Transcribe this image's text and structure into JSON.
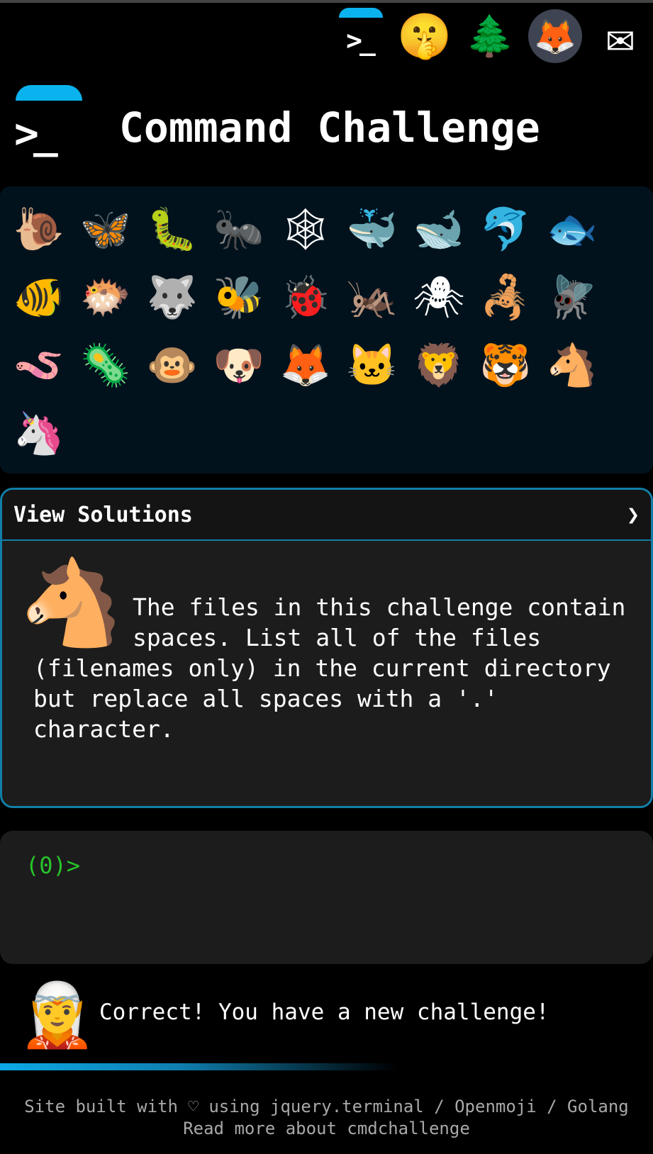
{
  "nav": {
    "terminal_glyph": ">_",
    "shush_icon": "🤫",
    "tree_icon": "🌲",
    "gitlab_icon": "🦊",
    "mail_icon": "✉"
  },
  "header": {
    "logo_glyph": ">_",
    "title": "Command Challenge"
  },
  "animals": [
    "🐌",
    "🦋",
    "🐛",
    "🐜",
    "🕸",
    "🐳",
    "🐋",
    "🐬",
    "🐟",
    "🐠",
    "🐡",
    "🐺",
    "🐝",
    "🐞",
    "🦗",
    "🕷",
    "🦂",
    "🪰",
    "🪱",
    "🦠",
    "🐵",
    "🐶",
    "🦊",
    "🐱",
    "🦁",
    "🐯",
    "🐴",
    "🦄"
  ],
  "solutions": {
    "label": "View Solutions",
    "chevron": "❯",
    "animal_icon": "🐴",
    "description": "The files in this challenge contain spaces. List all of the files (filenames only) in the current directory but replace all spaces with a '.' character."
  },
  "terminal": {
    "prompt": "(0)>"
  },
  "status": {
    "avatar_icon": "🧝",
    "message": "Correct! You have a new challenge!"
  },
  "footer": {
    "line1": "Site built with ♡ using jquery.terminal / Openmoji / Golang",
    "line2": "Read more about cmdchallenge"
  },
  "colors": {
    "accent": "#0bb3ee",
    "card_border": "#127ea8",
    "prompt": "#27c42a",
    "panel": "#02121d"
  }
}
